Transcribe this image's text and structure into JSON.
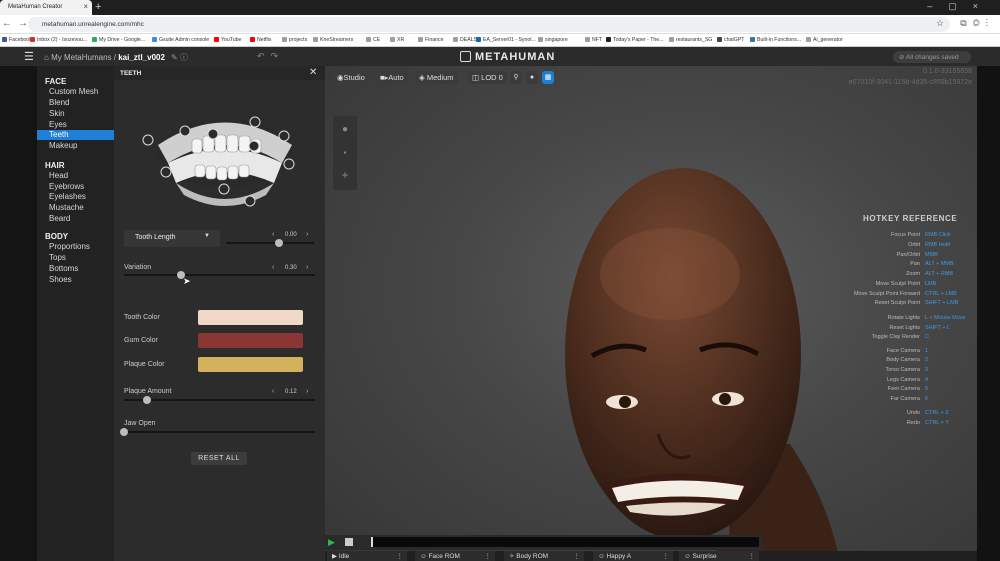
{
  "browser": {
    "tab_title": "MetaHuman Creator",
    "url": "metahuman.unrealengine.com/mhc",
    "bookmarks": [
      {
        "label": "Facebook",
        "color": "#3b5998"
      },
      {
        "label": "Inbox (2) - Isozevou...",
        "color": "#d93025"
      },
      {
        "label": "My Drive - Google...",
        "color": "#34a853"
      },
      {
        "label": "Gsuite Admin console",
        "color": "#4285f4"
      },
      {
        "label": "YouTube",
        "color": "#ff0000"
      },
      {
        "label": "Netflix",
        "color": "#e50914"
      },
      {
        "label": "projects",
        "color": "#9aa0a6"
      },
      {
        "label": "KneStreamers",
        "color": "#9aa0a6"
      },
      {
        "label": "CE",
        "color": "#9aa0a6"
      },
      {
        "label": "XR",
        "color": "#9aa0a6"
      },
      {
        "label": "Finance",
        "color": "#9aa0a6"
      },
      {
        "label": "DEALS",
        "color": "#9aa0a6"
      },
      {
        "label": "EA_Server01 - Synol...",
        "color": "#1565c0"
      },
      {
        "label": "singapore",
        "color": "#9aa0a6"
      },
      {
        "label": "NFT",
        "color": "#9aa0a6"
      },
      {
        "label": "Today's Paper - The...",
        "color": "#222"
      },
      {
        "label": "restaurants_SG",
        "color": "#9aa0a6"
      },
      {
        "label": "chatGPT",
        "color": "#444"
      },
      {
        "label": "Built-in Functions...",
        "color": "#3776ab"
      },
      {
        "label": "Ai_generator",
        "color": "#9aa0a6"
      }
    ]
  },
  "header": {
    "my_metahumans": "My MetaHumans",
    "separator": "/",
    "character_name": "kai_ztl_v002",
    "brand": "METAHUMAN",
    "save_status": "All changes saved"
  },
  "sidebar": {
    "sections": [
      {
        "title": "FACE",
        "items": [
          "Custom Mesh",
          "Blend",
          "Skin",
          "Eyes",
          "Teeth",
          "Makeup"
        ]
      },
      {
        "title": "HAIR",
        "items": [
          "Head",
          "Eyebrows",
          "Eyelashes",
          "Mustache",
          "Beard"
        ]
      },
      {
        "title": "BODY",
        "items": [
          "Proportions",
          "Tops",
          "Bottoms",
          "Shoes"
        ]
      }
    ],
    "active_item": "Teeth"
  },
  "panel": {
    "title": "TEETH",
    "dropdown": {
      "selected": "Tooth Length",
      "value": "0.00",
      "level": 0.6
    },
    "variation": {
      "label": "Variation",
      "value": "0.30",
      "level": 0.3
    },
    "tooth_color": {
      "label": "Tooth Color",
      "color": "#f1d8c6"
    },
    "gum_color": {
      "label": "Gum Color",
      "color": "#8a3634"
    },
    "plaque_color": {
      "label": "Plaque Color",
      "color": "#d4b25d"
    },
    "plaque_amount": {
      "label": "Plaque Amount",
      "value": "0.12",
      "level": 0.12
    },
    "jaw_open": {
      "label": "Jaw Open",
      "level": 0
    },
    "reset_all": "RESET ALL"
  },
  "viewport": {
    "toolbar": {
      "studio": "Studio",
      "auto": "Auto",
      "medium": "Medium",
      "lod": "LOD 0"
    },
    "version": "0.1.0-33165658",
    "build_id": "e07010f-3041-115b-4d35-c859b15972e",
    "hotkey_title": "HOTKEY REFERENCE",
    "hotkeys": [
      {
        "action": "Focus Point",
        "keys": "RMB Click"
      },
      {
        "action": "Orbit",
        "keys": "RMB Hold"
      },
      {
        "action": "Pan/Orbit",
        "keys": "MMB"
      },
      {
        "action": "Pan",
        "keys": "ALT + MMB"
      },
      {
        "action": "Zoom",
        "keys": "ALT + RMB"
      },
      {
        "action": "Move Sculpt Point",
        "keys": "LMB"
      },
      {
        "action": "Move Sculpt Point Forward",
        "keys": "CTRL + LMB"
      },
      {
        "action": "Reset Sculpt Point",
        "keys": "SHIFT + LMB"
      },
      {
        "action": "Rotate Lights",
        "keys": "L + Mouse Move"
      },
      {
        "action": "Reset Lights",
        "keys": "SHIFT + L"
      },
      {
        "action": "Toggle Clay Render",
        "keys": "C"
      },
      {
        "action": "Face Camera",
        "keys": "1"
      },
      {
        "action": "Body Camera",
        "keys": "2"
      },
      {
        "action": "Torso Camera",
        "keys": "3"
      },
      {
        "action": "Legs Camera",
        "keys": "4"
      },
      {
        "action": "Feet Camera",
        "keys": "5"
      },
      {
        "action": "Far Camera",
        "keys": "6"
      },
      {
        "action": "Undo",
        "keys": "CTRL + Z"
      },
      {
        "action": "Redo",
        "keys": "CTRL + Y"
      }
    ]
  },
  "animations": [
    {
      "label": "Idle"
    },
    {
      "label": "Face ROM"
    },
    {
      "label": "Body ROM"
    },
    {
      "label": "Happy A"
    },
    {
      "label": "Surprise"
    }
  ]
}
